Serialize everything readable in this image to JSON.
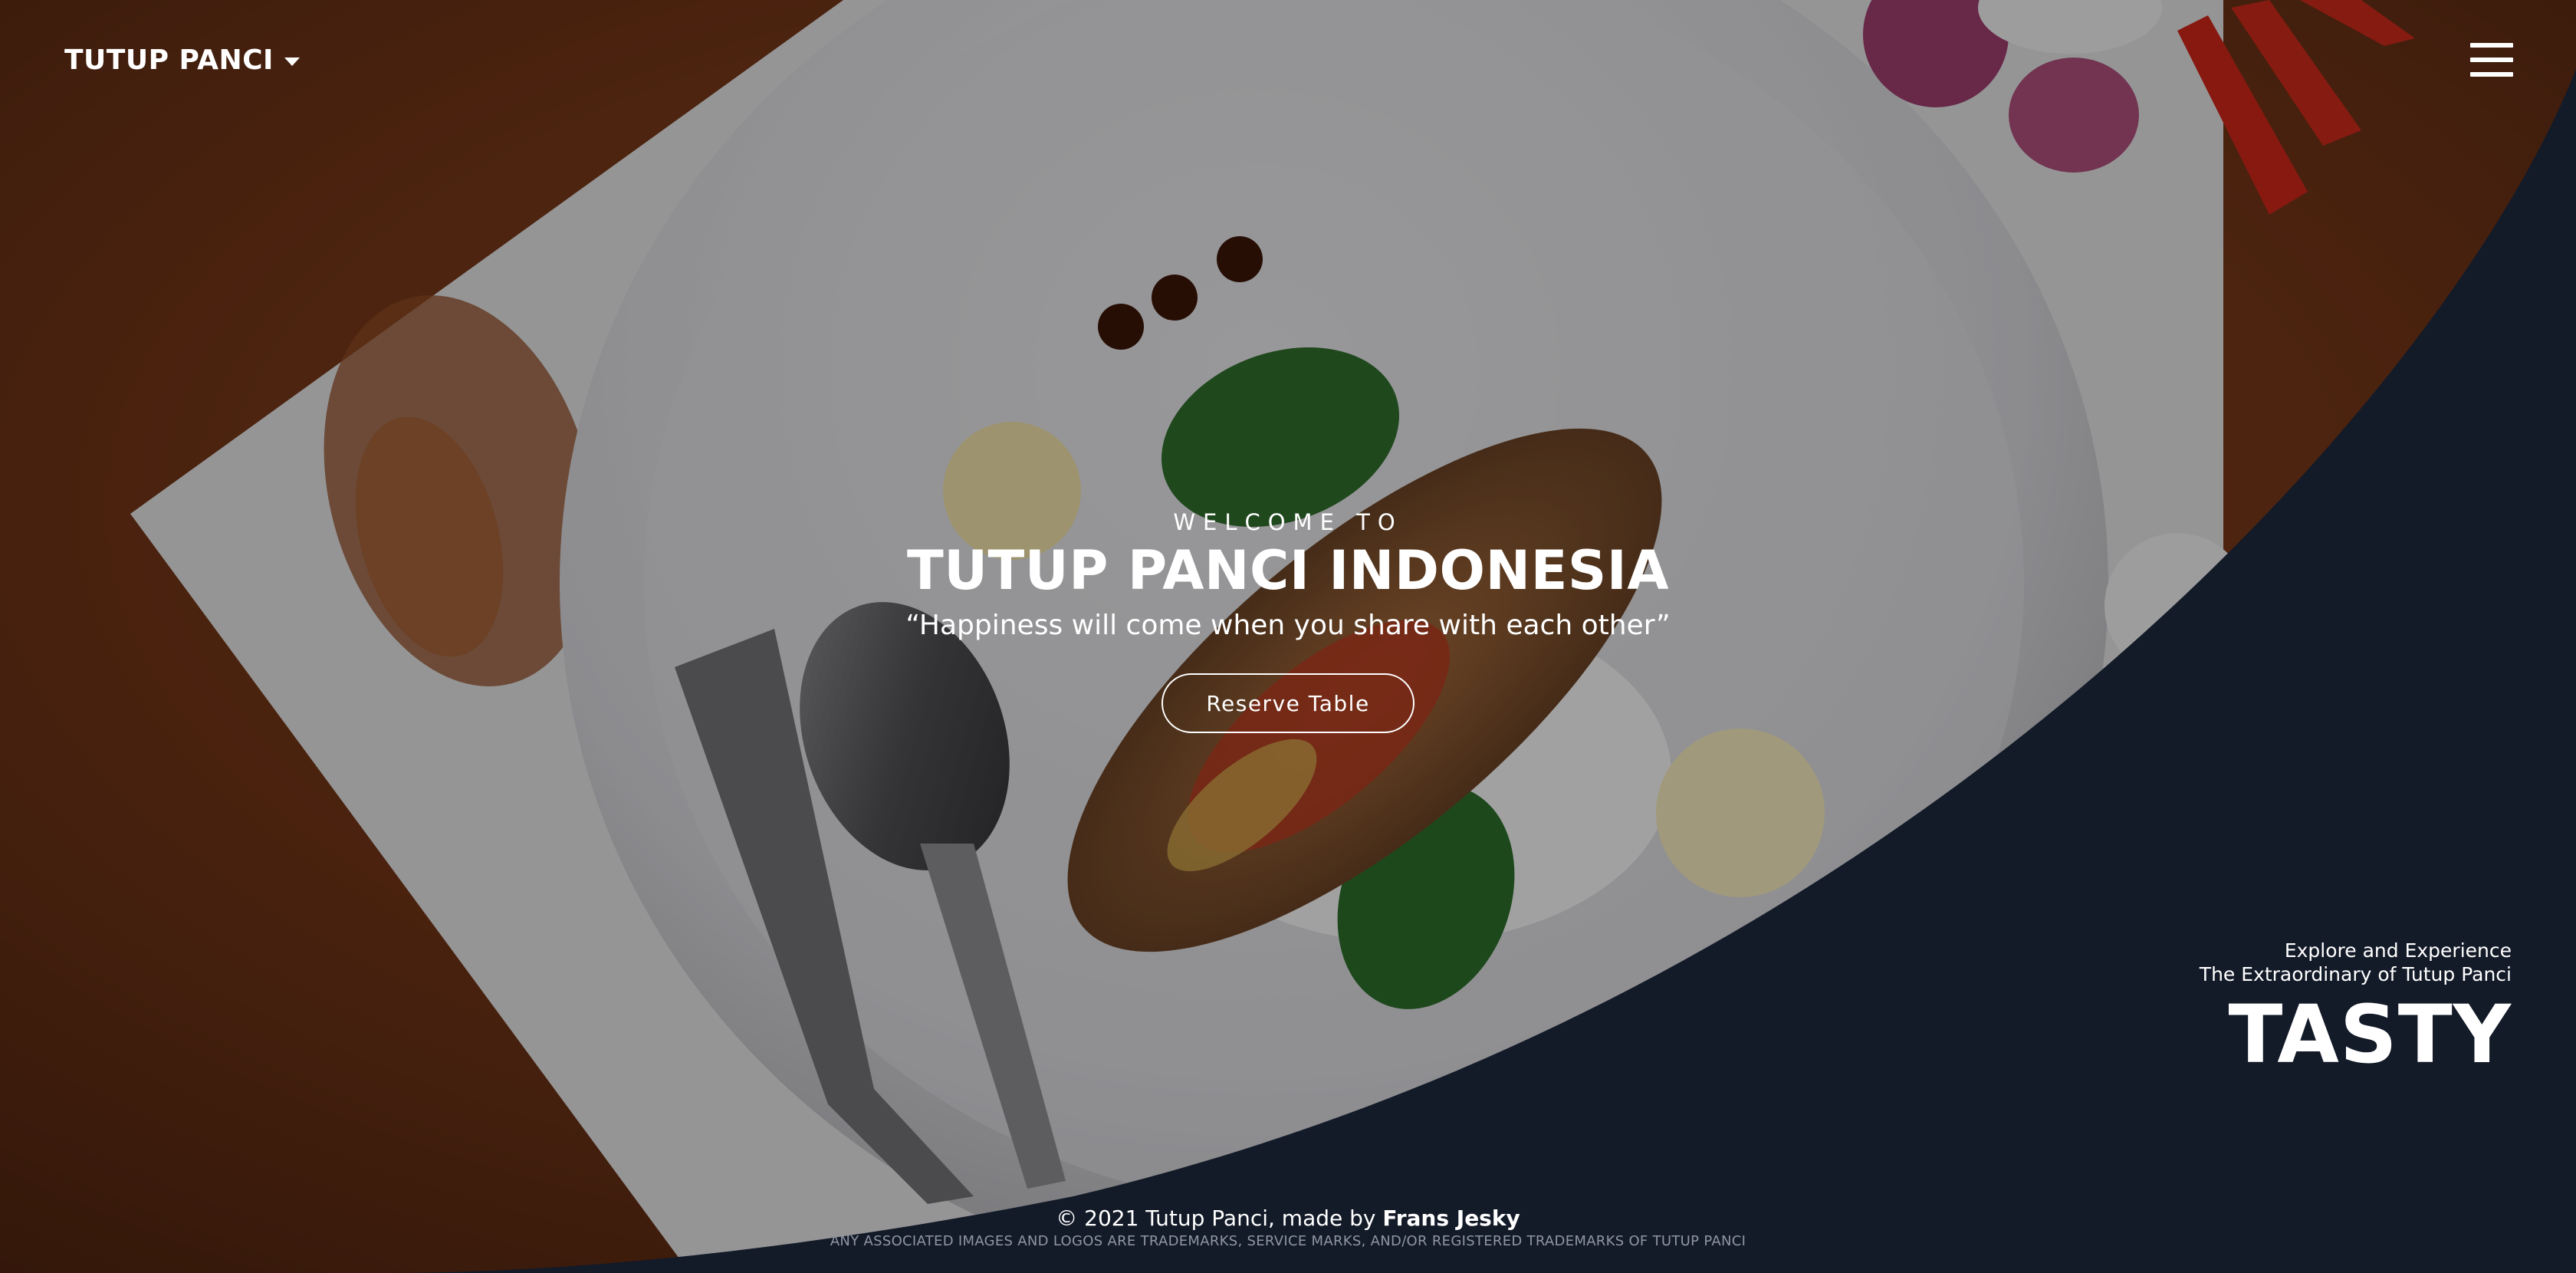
{
  "nav": {
    "brand": "TUTUP PANCI",
    "brand_icon": "chevron-down-icon",
    "menu_icon": "hamburger-menu-icon"
  },
  "hero": {
    "welcome": "WELCOME TO",
    "title": "TUTUP PANCI INDONESIA",
    "quote": "“Happiness will come when you share with each other”",
    "reserve_label": "Reserve Table"
  },
  "tasty": {
    "line1": "Explore and Experience",
    "line2": "The Extraordinary of Tutup Panci",
    "headline": "TASTY"
  },
  "footer": {
    "copyright_prefix": "© 2021 Tutup Panci, made by ",
    "author": "Frans Jesky",
    "legal": "ANY ASSOCIATED IMAGES AND LOGOS ARE TRADEMARKS, SERVICE MARKS, AND/OR REGISTERED TRADEMARKS OF TUTUP PANCI"
  },
  "colors": {
    "navy_panel": "#131a28",
    "wood": "#7a3a1c",
    "plate": "#d9d9dc"
  }
}
